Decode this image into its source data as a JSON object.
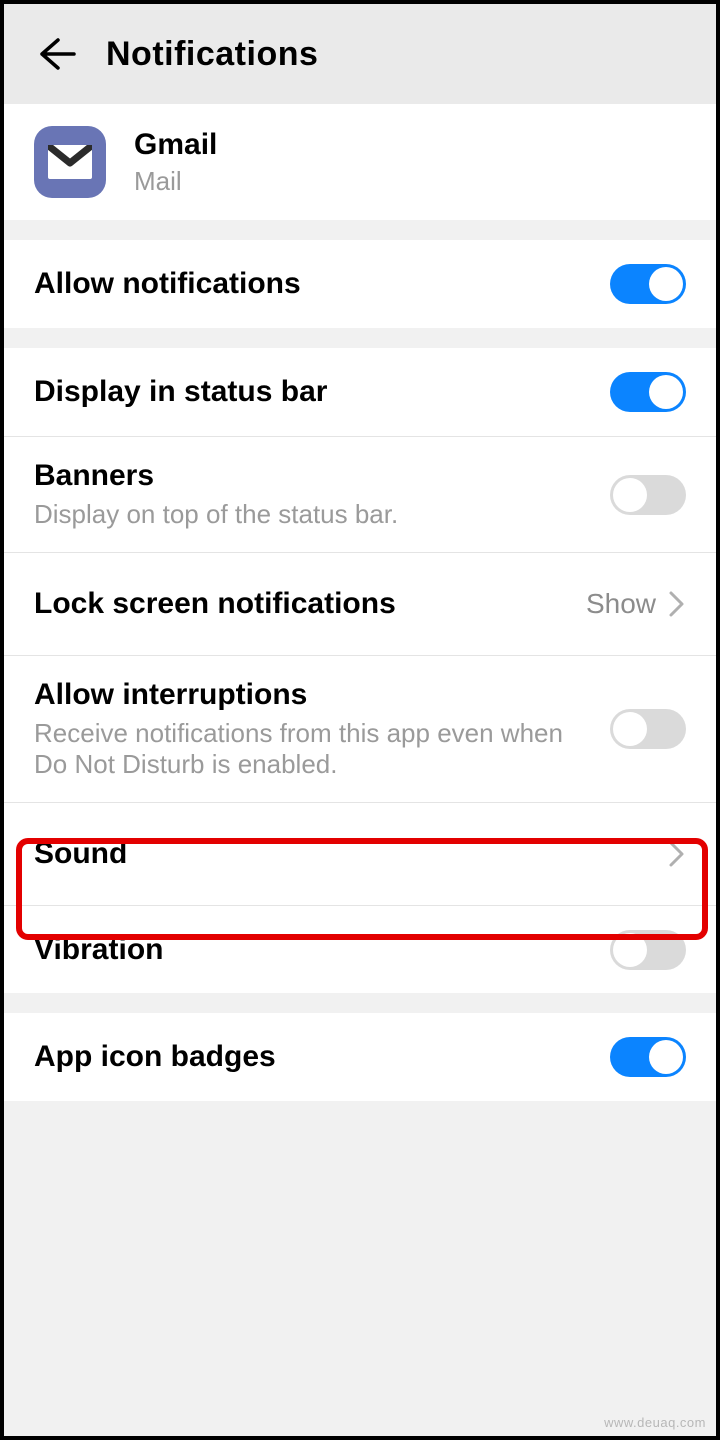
{
  "header": {
    "title": "Notifications"
  },
  "app": {
    "name": "Gmail",
    "subtitle": "Mail"
  },
  "rows": {
    "allow_notifications": "Allow notifications",
    "display_status_bar": "Display in status bar",
    "banners": {
      "title": "Banners",
      "sub": "Display on top of the status bar."
    },
    "lock_screen": {
      "title": "Lock screen notifications",
      "value": "Show"
    },
    "interruptions": {
      "title": "Allow interruptions",
      "sub": "Receive notifications from this app even when Do Not Disturb is enabled."
    },
    "sound": "Sound",
    "vibration": "Vibration",
    "badges": "App icon badges"
  },
  "toggles": {
    "allow_notifications": true,
    "display_status_bar": true,
    "banners": false,
    "interruptions": false,
    "vibration": false,
    "badges": true
  },
  "watermark": "www.deuaq.com"
}
